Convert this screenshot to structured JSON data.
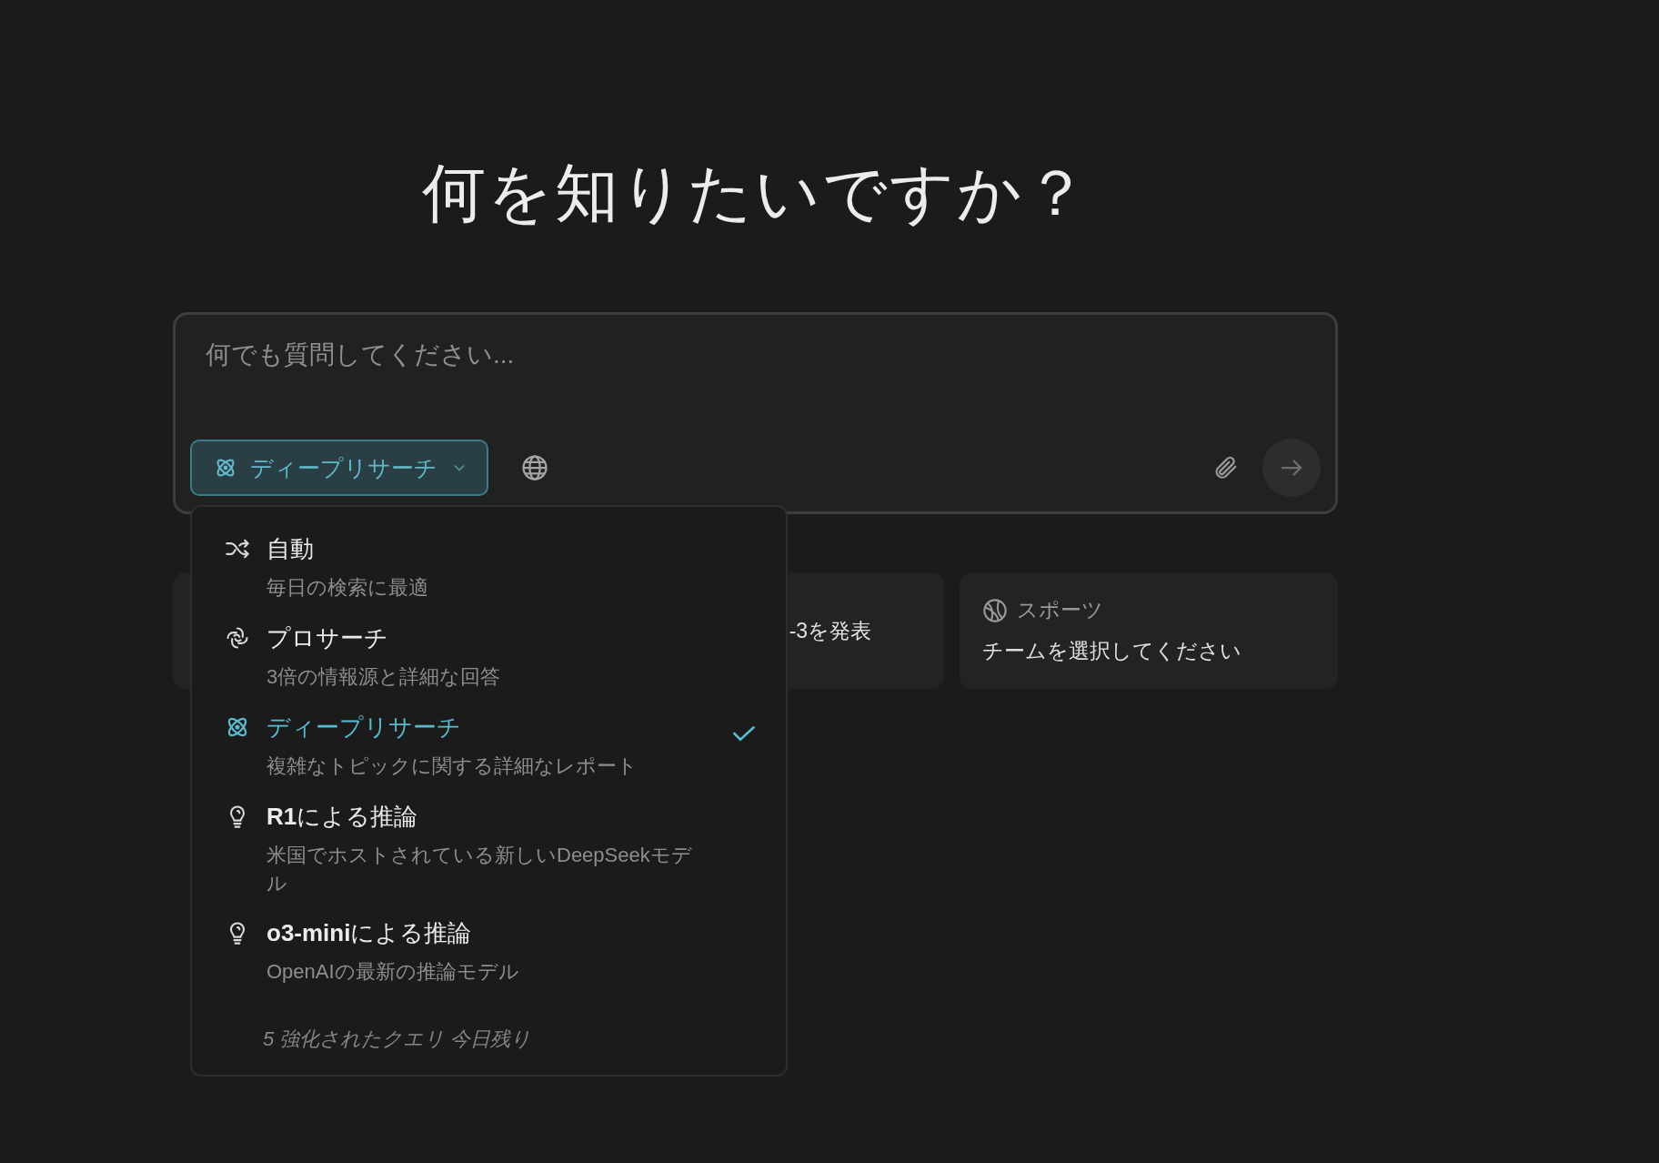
{
  "heading": "何を知りたいですか？",
  "query_box": {
    "placeholder": "何でも質問してください...",
    "mode_button": {
      "kind": "atom",
      "label": "ディープリサーチ"
    }
  },
  "mode_menu": {
    "items": [
      {
        "kind": "shuffle",
        "title": "自動",
        "description": "毎日の検索に最適",
        "selected": false
      },
      {
        "kind": "swirl",
        "title": "プロサーチ",
        "description": "3倍の情報源と詳細な回答",
        "selected": false
      },
      {
        "kind": "atom",
        "title": "ディープリサーチ",
        "description": "複雑なトピックに関する詳細なレポート",
        "selected": true
      },
      {
        "kind": "bulb",
        "title": "**R1**による推論",
        "description": "米国でホストされている新しいDeepSeekモデル",
        "selected": false
      },
      {
        "kind": "bulb",
        "title": "**o3-mini**による推論",
        "description": "OpenAIの最新の推論モデル",
        "selected": false
      }
    ],
    "footer": "5 強化されたクエリ 今日残り"
  },
  "suggestions": [
    {
      "kind": "covered"
    },
    {
      "kind": "text",
      "text": "-3を発表"
    },
    {
      "kind": "topic",
      "topic": "スポーツ",
      "text": "チームを選択してください"
    }
  ]
}
